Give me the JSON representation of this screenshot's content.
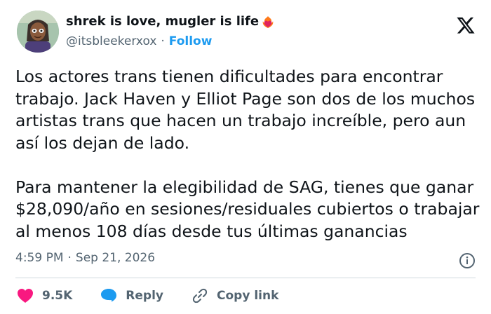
{
  "tweet": {
    "display_name": "shrek is love, mugler is life",
    "name_emoji_icon": "heart-on-fire-icon",
    "handle": "@itsbleekerxox",
    "separator": "·",
    "follow_label": "Follow",
    "paragraphs": [
      "Los actores trans tienen dificultades para encontrar trabajo. Jack Haven y Elliot Page son dos de los muchos artistas trans que hacen un trabajo increíble, pero aun así los dejan de lado.",
      "Para mantener la elegibilidad de SAG, tienes que ganar $28,090/año en sesiones/residuales cubiertos o trabajar al menos 108 días desde tus últimas ganancias"
    ],
    "time": "4:59 PM",
    "date": "Sep 21, 2026"
  },
  "actions": {
    "likes_count": "9.5K",
    "reply_label": "Reply",
    "copy_link_label": "Copy link"
  },
  "colors": {
    "accent": "#1d9bf0",
    "like": "#f91880",
    "text": "#0f1419",
    "muted": "#536471"
  }
}
